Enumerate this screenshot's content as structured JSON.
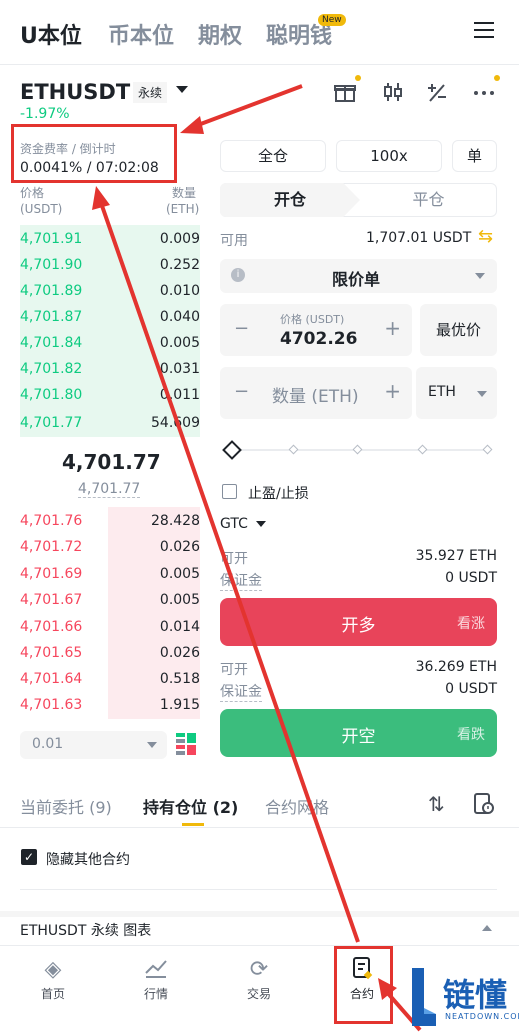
{
  "top_tabs": [
    "U本位",
    "币本位",
    "期权",
    "聪明钱"
  ],
  "new_badge": "New",
  "symbol": "ETHUSDT",
  "perp_label": "永续",
  "change": "-1.97%",
  "funding_label": "资金费率 / 倒计时",
  "funding_value": "0.0041% / 07:02:08",
  "ob_price_label": "价格",
  "ob_price_unit": "(USDT)",
  "ob_qty_label": "数量",
  "ob_qty_unit": "(ETH)",
  "bids": [
    {
      "price": "4,701.91",
      "qty": "0.009"
    },
    {
      "price": "4,701.90",
      "qty": "0.252"
    },
    {
      "price": "4,701.89",
      "qty": "0.010"
    },
    {
      "price": "4,701.87",
      "qty": "0.040"
    },
    {
      "price": "4,701.84",
      "qty": "0.005"
    },
    {
      "price": "4,701.82",
      "qty": "0.031"
    },
    {
      "price": "4,701.80",
      "qty": "0.011"
    },
    {
      "price": "4,701.77",
      "qty": "54.609"
    }
  ],
  "last_price": "4,701.77",
  "mark_price": "4,701.77",
  "asks": [
    {
      "price": "4,701.76",
      "qty": "28.428"
    },
    {
      "price": "4,701.72",
      "qty": "0.026"
    },
    {
      "price": "4,701.69",
      "qty": "0.005"
    },
    {
      "price": "4,701.67",
      "qty": "0.005"
    },
    {
      "price": "4,701.66",
      "qty": "0.014"
    },
    {
      "price": "4,701.65",
      "qty": "0.026"
    },
    {
      "price": "4,701.64",
      "qty": "0.518"
    },
    {
      "price": "4,701.63",
      "qty": "1.915"
    }
  ],
  "precision": "0.01",
  "margin_mode": "全仓",
  "leverage": "100x",
  "position_mode": "单",
  "open_tab": "开仓",
  "close_tab": "平仓",
  "available_label": "可用",
  "available_value": "1,707.01 USDT",
  "order_type": "限价单",
  "price_field_label": "价格 (USDT)",
  "price_field_value": "4702.26",
  "best_price": "最优价",
  "qty_placeholder": "数量 (ETH)",
  "qty_unit": "ETH",
  "tpsl_label": "止盈/止损",
  "tif": "GTC",
  "long_open_label": "可开",
  "long_open_value": "35.927 ETH",
  "long_margin_label": "保证金",
  "long_margin_value": "0 USDT",
  "long_btn": "开多",
  "long_sub": "看涨",
  "short_open_label": "可开",
  "short_open_value": "36.269 ETH",
  "short_margin_label": "保证金",
  "short_margin_value": "0 USDT",
  "short_btn": "开空",
  "short_sub": "看跌",
  "bottom_tabs": [
    "当前委托 (9)",
    "持有仓位 (2)",
    "合约网格"
  ],
  "hide_other": "隐藏其他合约",
  "chart_row": "ETHUSDT 永续  图表",
  "nav": [
    "首页",
    "行情",
    "交易",
    "合约"
  ],
  "watermark_main": "链懂",
  "watermark_sub": "NEATDOWN.COM",
  "colors": {
    "green": "#0ecb81",
    "red": "#f6465d",
    "yellow": "#f0b90b",
    "annotation": "#e3342f"
  }
}
